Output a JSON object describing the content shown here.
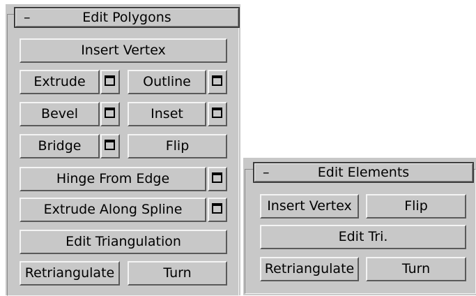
{
  "edit_polygons": {
    "collapse_symbol": "–",
    "title": "Edit Polygons",
    "insert_vertex": "Insert Vertex",
    "extrude": "Extrude",
    "outline": "Outline",
    "bevel": "Bevel",
    "inset": "Inset",
    "bridge": "Bridge",
    "flip": "Flip",
    "hinge_from_edge": "Hinge From Edge",
    "extrude_along_spline": "Extrude Along Spline",
    "edit_triangulation": "Edit Triangulation",
    "retriangulate": "Retriangulate",
    "turn": "Turn"
  },
  "edit_elements": {
    "collapse_symbol": "–",
    "title": "Edit Elements",
    "insert_vertex": "Insert Vertex",
    "flip": "Flip",
    "edit_tri": "Edit Tri.",
    "retriangulate": "Retriangulate",
    "turn": "Turn"
  },
  "colors": {
    "panel_bg": "#c8c8c8",
    "highlight": "#f4f4f4",
    "shadow": "#5a5a5a",
    "header_border": "#3c3c3c"
  },
  "icons": {
    "settings_box": "caddy-settings-icon"
  }
}
